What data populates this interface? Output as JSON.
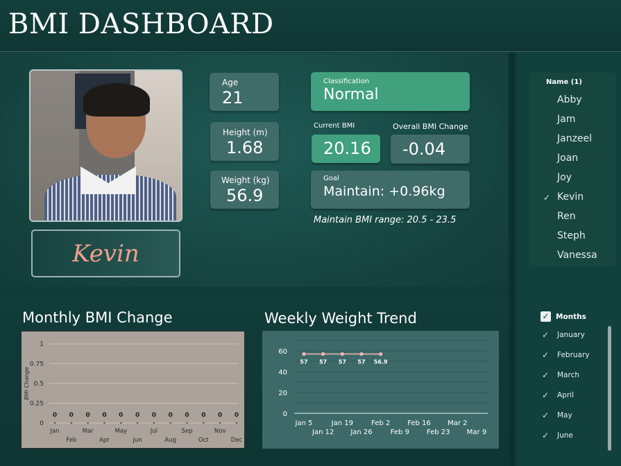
{
  "header": {
    "title": "BMI DASHBOARD"
  },
  "profile": {
    "name": "Kevin"
  },
  "stats": {
    "age": {
      "label": "Age",
      "value": "21"
    },
    "height": {
      "label": "Height (m)",
      "value": "1.68"
    },
    "weight": {
      "label": "Weight (kg)",
      "value": "56.9"
    }
  },
  "classification": {
    "label": "Classification",
    "value": "Normal"
  },
  "current_bmi": {
    "label": "Current BMI",
    "value": "20.16"
  },
  "overall_change": {
    "label": "Overall BMI Change",
    "value": "-0.04"
  },
  "goal": {
    "label": "Goal",
    "value": "Maintain: +0.96kg",
    "note": "Maintain  BMI range: 20.5 - 23.5"
  },
  "name_slicer": {
    "title": "Name (1)",
    "items": [
      "Abby",
      "Jam",
      "Janzeel",
      "Joan",
      "Joy",
      "Kevin",
      "Ren",
      "Steph",
      "Vanessa"
    ],
    "selected": "Kevin"
  },
  "months_slicer": {
    "title": "Months",
    "items": [
      "January",
      "February",
      "March",
      "April",
      "May",
      "June"
    ],
    "all_checked": true
  },
  "colors": {
    "accent": "#41a07e",
    "card": "#3f6b68",
    "name": "#f0a08a",
    "weight_line": "#f4b6b0"
  },
  "chart_titles": {
    "monthly": "Monthly BMI Change",
    "weekly": "Weekly Weight Trend"
  },
  "chart_data": [
    {
      "type": "line",
      "title": "Monthly BMI Change",
      "ylabel": "BMI Change",
      "xlabel": "",
      "categories": [
        "Jan",
        "Feb",
        "Mar",
        "Apr",
        "May",
        "Jun",
        "Jul",
        "Aug",
        "Sep",
        "Oct",
        "Nov",
        "Dec"
      ],
      "values": [
        0,
        0,
        0,
        0,
        0,
        0,
        0,
        0,
        0,
        0,
        0,
        0
      ],
      "data_labels": [
        "0",
        "0",
        "0",
        "0",
        "0",
        "0",
        "0",
        "0",
        "0",
        "0",
        "0",
        "0"
      ],
      "yticks": [
        "0",
        "0.25",
        "0.5",
        "0.75",
        "1"
      ],
      "ylim": [
        0,
        1
      ],
      "grid": true
    },
    {
      "type": "line",
      "title": "Weekly Weight Trend",
      "xlabel": "",
      "ylabel": "",
      "x_ticks": [
        "Jan 5",
        "Jan 12",
        "Jan 19",
        "Jan 26",
        "Feb 2",
        "Feb 9",
        "Feb 16",
        "Feb 23",
        "Mar 2",
        "Mar 9"
      ],
      "x": [
        "Jan 5",
        "Jan 12",
        "Jan 19",
        "Jan 26",
        "Feb 2"
      ],
      "values": [
        57,
        57,
        57,
        57,
        56.9
      ],
      "data_labels": [
        "57",
        "57",
        "57",
        "57",
        "56.9"
      ],
      "yticks": [
        "0",
        "20",
        "40",
        "60"
      ],
      "ylim": [
        0,
        70
      ],
      "grid": true
    }
  ]
}
